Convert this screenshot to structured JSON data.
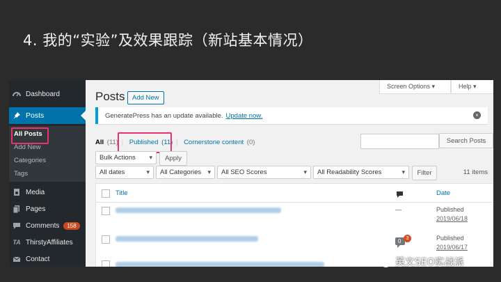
{
  "slide": {
    "title": "4. 我的“实验”及效果跟踪（新站基本情况）"
  },
  "sidebar": {
    "items": [
      {
        "label": "Dashboard",
        "icon": "dashboard-icon"
      },
      {
        "label": "Posts",
        "icon": "pushpin-icon"
      },
      {
        "label": "Media",
        "icon": "media-icon"
      },
      {
        "label": "Pages",
        "icon": "pages-icon"
      },
      {
        "label": "Comments",
        "icon": "comments-icon",
        "badge": "158"
      },
      {
        "label": "ThirstyAffiliates",
        "icon": "ta-icon",
        "icon_text": "TA"
      },
      {
        "label": "Contact",
        "icon": "envelope-icon"
      }
    ],
    "submenu": [
      "All Posts",
      "Add New",
      "Categories",
      "Tags"
    ]
  },
  "top_buttons": {
    "screen_options": "Screen Options ▾",
    "help": "Help ▾"
  },
  "header": {
    "title": "Posts",
    "add_new": "Add New"
  },
  "notice": {
    "text": "GeneratePress has an update available.",
    "link": "Update now.",
    "icon": "close-circle-icon"
  },
  "views": {
    "all": "All",
    "all_count": "(11)",
    "published": "Published",
    "published_count": "(11)",
    "cornerstone": "Cornerstone content",
    "cornerstone_count": "(0)",
    "separator": "|"
  },
  "search": {
    "value": "",
    "button": "Search Posts"
  },
  "bulk": {
    "selected": "Bulk Actions",
    "apply": "Apply"
  },
  "filters": {
    "dates": "All dates",
    "categories": "All Categories",
    "seo": "All SEO Scores",
    "readability": "All Readability Scores",
    "button": "Filter"
  },
  "items_count": "11 items",
  "table": {
    "columns": {
      "title": "Title",
      "comments_icon": "comment-bubble-icon",
      "date": "Date"
    },
    "rows": [
      {
        "comments": "—",
        "status": "Published",
        "date": "2019/06/18"
      },
      {
        "comments": "0",
        "pending": "3",
        "status": "Published",
        "date": "2019/06/17"
      }
    ]
  },
  "watermark": {
    "text": "英文SEO实战派",
    "icon": "wechat-icon"
  },
  "colors": {
    "admin_bar": "#23282d",
    "accent": "#0073aa",
    "highlight": "#e8336e",
    "badge": "#ca4a1f"
  }
}
